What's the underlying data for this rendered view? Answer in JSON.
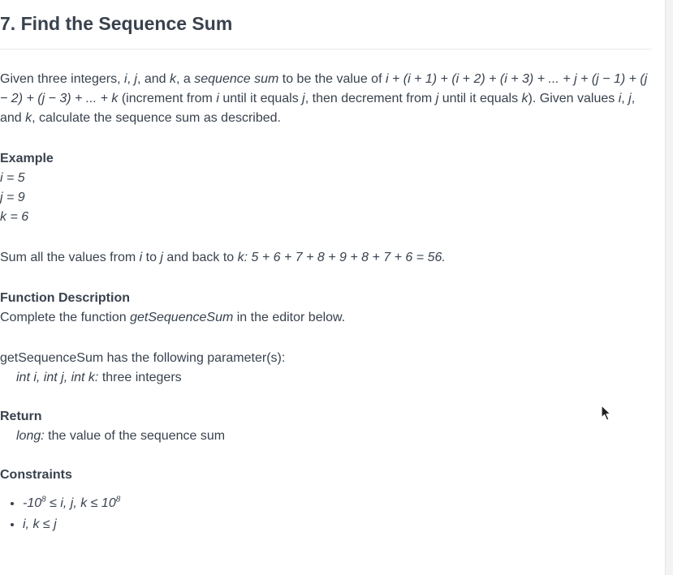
{
  "problem": {
    "title": "7. Find the Sequence Sum",
    "description": {
      "t1": "Given three integers, ",
      "v_i": "i",
      "t2": ", ",
      "v_j": "j",
      "t3": ", and ",
      "v_k": "k",
      "t4": ", a ",
      "term": "sequence sum",
      "t5": " to be the value of ",
      "formula": "i + (i + 1) + (i + 2) + (i + 3) + ... + j + (j − 1) + (j − 2) + (j − 3) + ... + k",
      "t6": " (increment from ",
      "v_i2": "i",
      "t7": " until it equals ",
      "v_j2": "j",
      "t8": ", then decrement from ",
      "v_j3": "j",
      "t9": " until it equals ",
      "v_k2": "k",
      "t10": "). Given values ",
      "v_i3": "i",
      "t11": ", ",
      "v_j4": "j",
      "t12": ", and ",
      "v_k3": "k",
      "t13": ", calculate the sequence sum as described."
    },
    "example": {
      "heading": "Example",
      "lines": [
        "i = 5",
        "j = 9",
        "k = 6"
      ],
      "sum_t1": "Sum all the values from ",
      "sum_i": "i",
      "sum_t2": " to ",
      "sum_j": "j",
      "sum_t3": " and back to ",
      "sum_expr": "k: 5 + 6 + 7 + 8 + 9 + 8 + 7 + 6 = 56."
    },
    "function_description": {
      "heading": "Function Description",
      "t1": "Complete the function ",
      "fn_name": "getSequenceSum",
      "t2": " in the editor below.",
      "params_intro": "getSequenceSum has the following parameter(s):",
      "params_sig": "int i, int j, int k:",
      "params_desc": " three integers"
    },
    "return": {
      "heading": "Return",
      "type": "long:",
      "desc": " the value of the sequence sum"
    },
    "constraints": {
      "heading": "Constraints",
      "c1_a": "-10",
      "c1_exp1": "8",
      "c1_b": " ≤ i, j, k ≤ 10",
      "c1_exp2": "8",
      "c2": "i, k ≤ j"
    }
  },
  "colors": {
    "text": "#39424e",
    "rule": "#e8e9ec",
    "background": "#ffffff"
  },
  "icons": {
    "cursor": "mouse-pointer-icon"
  }
}
